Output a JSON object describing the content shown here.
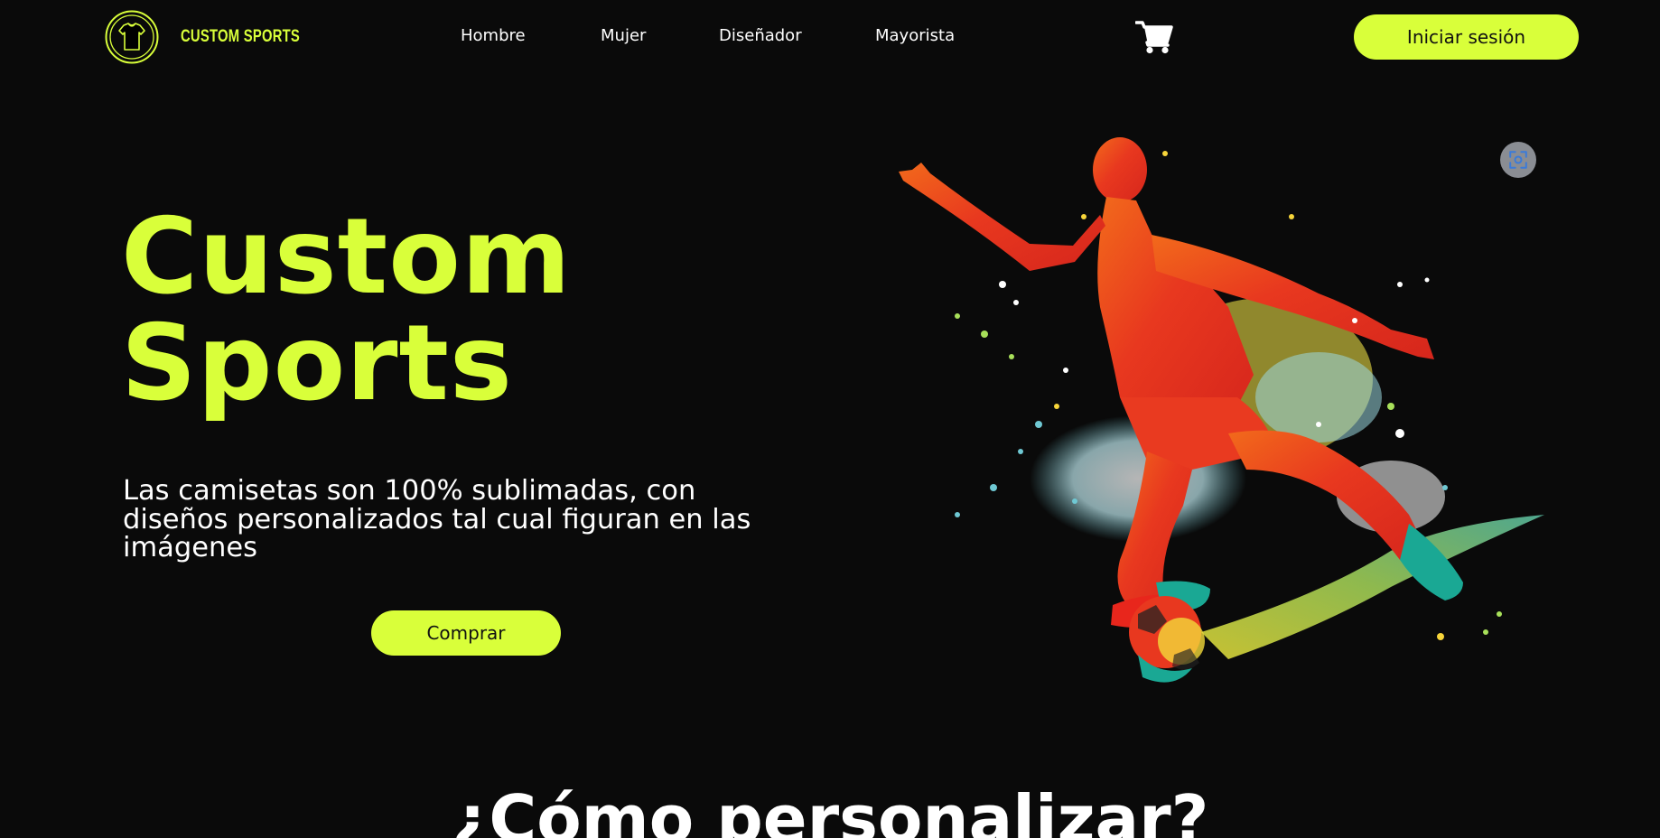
{
  "brand": {
    "name": "CUSTOM SPORTS",
    "accent_color": "#d9ff3a",
    "background_color": "#0a0a0a",
    "logo_icon": "tshirt-badge-icon"
  },
  "header": {
    "nav": [
      {
        "label": "Hombre"
      },
      {
        "label": "Mujer"
      },
      {
        "label": "Diseñador"
      },
      {
        "label": "Mayorista"
      }
    ],
    "cart_icon": "shopping-cart-icon",
    "login_label": "Iniciar sesión"
  },
  "hero": {
    "title_line1": "Custom",
    "title_line2": "Sports",
    "description": "Las camisetas son 100% sublimadas, con diseños personalizados tal cual figuran en las imágenes",
    "cta_label": "Comprar",
    "image_icon": "soccer-player-paint-splash-illustration",
    "image_action_icon": "visual-search-icon"
  },
  "next_section": {
    "heading": "¿Cómo personalizar?"
  }
}
